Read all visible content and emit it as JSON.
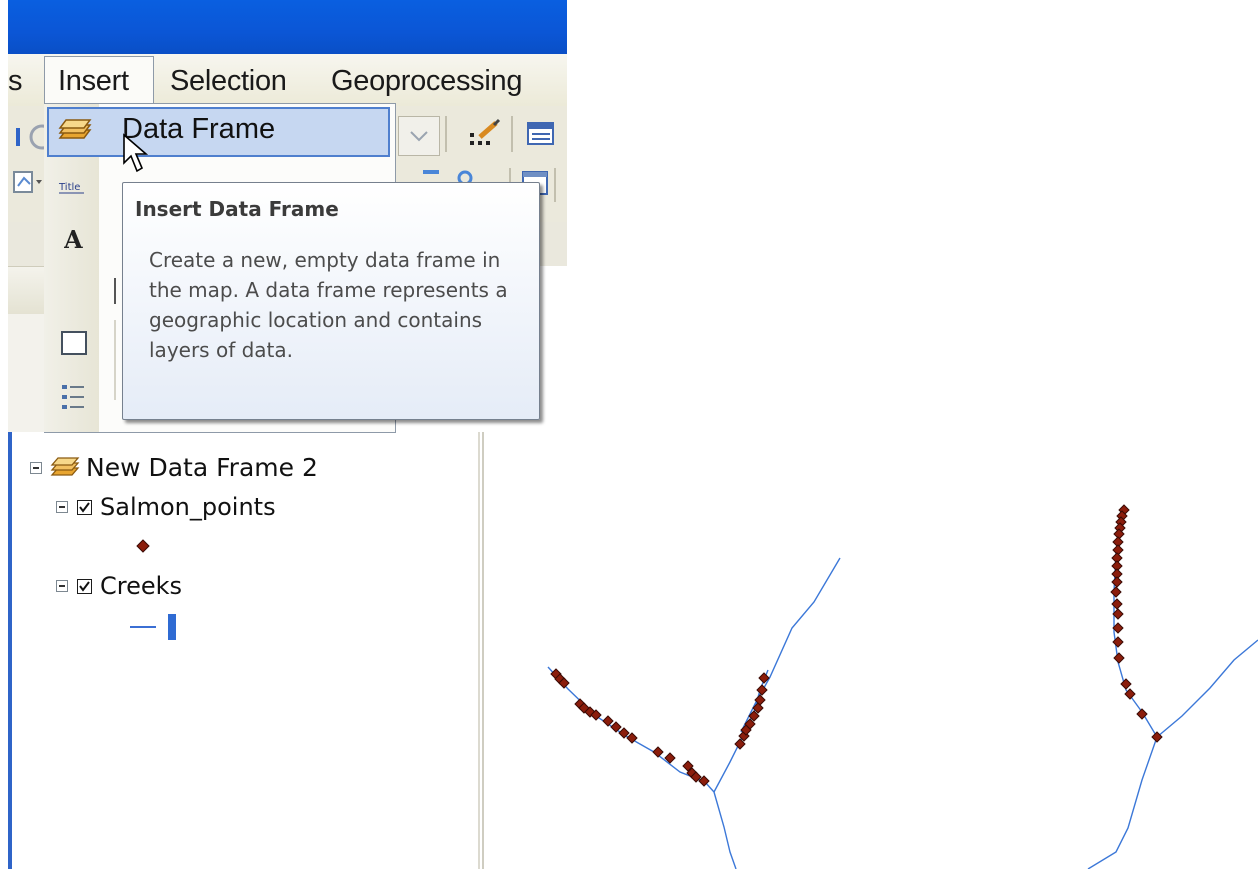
{
  "menubar": {
    "items": [
      {
        "label": "s"
      },
      {
        "label": "Insert"
      },
      {
        "label": "Selection"
      },
      {
        "label": "Geoprocessing"
      }
    ]
  },
  "insert_menu": {
    "items": [
      {
        "label": "Data Frame",
        "icon": "data-frame-icon",
        "state": "hovered"
      }
    ],
    "icons": [
      "title-icon",
      "text-icon",
      "neatline-icon",
      "legend-icon"
    ]
  },
  "tooltip": {
    "title": "Insert Data Frame",
    "body": "Create a new, empty data frame in the map. A data frame represents a geographic location and contains layers of data."
  },
  "toc": {
    "data_frame": {
      "label": "New Data Frame 2",
      "expanded": true
    },
    "layers": [
      {
        "label": "Salmon_points",
        "checked": true,
        "expanded": true,
        "symbol": "point",
        "symbol_color": "#8b1d0c"
      },
      {
        "label": "Creeks",
        "checked": true,
        "expanded": true,
        "symbol": "line",
        "symbol_color": "#3b6fd4"
      }
    ]
  },
  "map": {
    "creek_color": "#3c78d8",
    "point_color": "#8b1d0c"
  },
  "colors": {
    "title_bar": "#0b56d6",
    "menu_highlight": "#c6d7f1",
    "toc_border": "#2f64c8"
  }
}
